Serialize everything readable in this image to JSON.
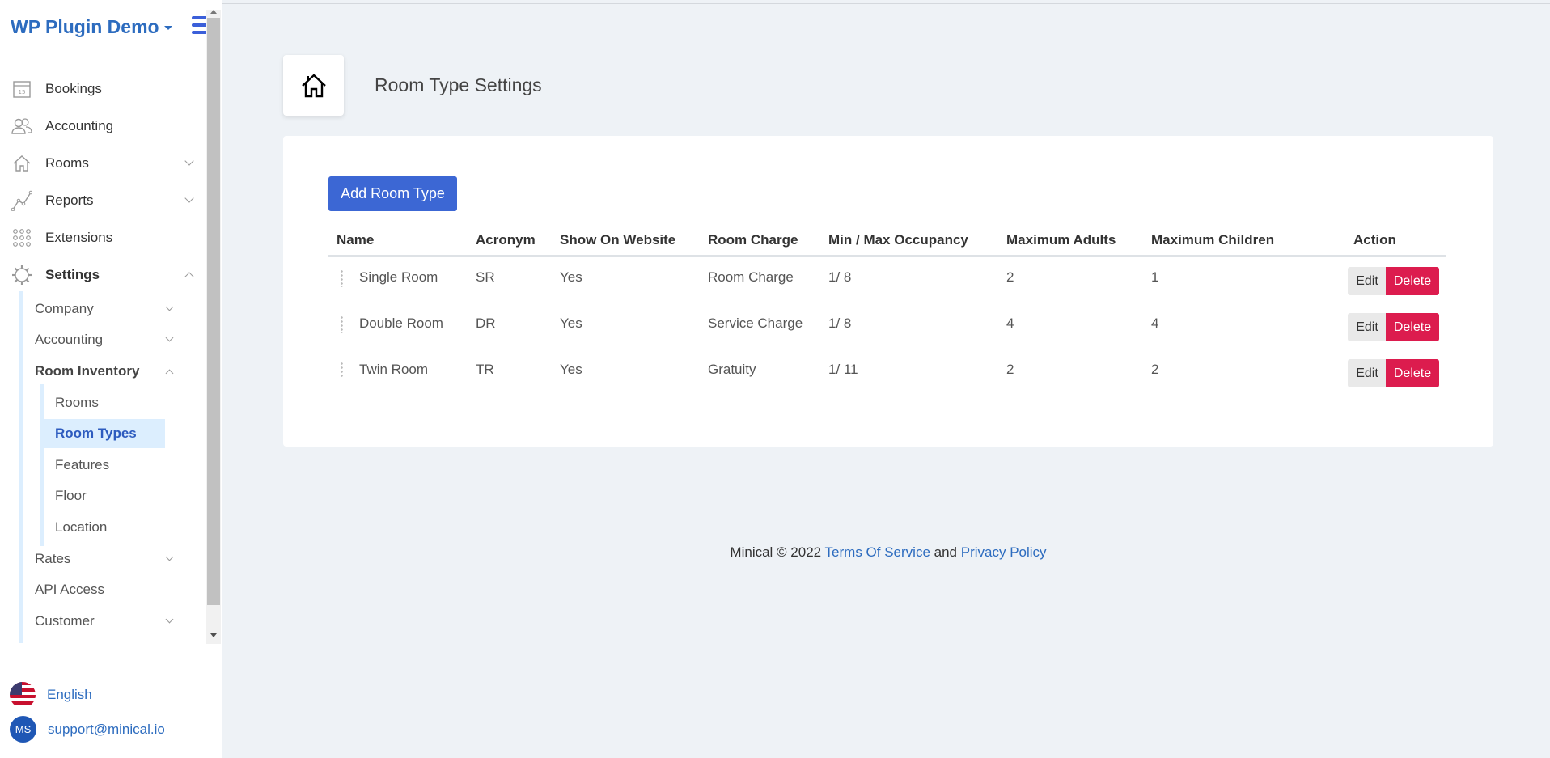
{
  "app": {
    "brand": "WP Plugin Demo"
  },
  "sidebar": {
    "items": [
      {
        "label": "Bookings",
        "icon": "calendar-icon"
      },
      {
        "label": "Accounting",
        "icon": "users-icon"
      },
      {
        "label": "Rooms",
        "icon": "home-icon"
      },
      {
        "label": "Reports",
        "icon": "chart-line-icon"
      },
      {
        "label": "Extensions",
        "icon": "grid-icon"
      },
      {
        "label": "Settings",
        "icon": "gear-icon"
      }
    ],
    "settings_sub": [
      {
        "label": "Company"
      },
      {
        "label": "Accounting"
      },
      {
        "label": "Room Inventory"
      },
      {
        "label": "Rates"
      },
      {
        "label": "API Access"
      },
      {
        "label": "Customer"
      }
    ],
    "inventory_sub": [
      {
        "label": "Rooms"
      },
      {
        "label": "Room Types"
      },
      {
        "label": "Features"
      },
      {
        "label": "Floor"
      },
      {
        "label": "Location"
      }
    ],
    "language": "English",
    "avatar_initials": "MS",
    "user_email": "support@minical.io"
  },
  "page": {
    "title": "Room Type Settings",
    "add_button": "Add Room Type"
  },
  "table": {
    "headers": [
      "Name",
      "Acronym",
      "Show On Website",
      "Room Charge",
      "Min / Max Occupancy",
      "Maximum Adults",
      "Maximum Children",
      "Action"
    ],
    "rows": [
      [
        "Single Room",
        "SR",
        "Yes",
        "Room Charge",
        "1/ 8",
        "2",
        "1"
      ],
      [
        "Double Room",
        "DR",
        "Yes",
        "Service Charge",
        "1/ 8",
        "4",
        "4"
      ],
      [
        "Twin Room",
        "TR",
        "Yes",
        "Gratuity",
        "1/ 11",
        "2",
        "2"
      ]
    ],
    "edit_label": "Edit",
    "delete_label": "Delete"
  },
  "footer": {
    "prefix": "Minical © 2022",
    "terms": "Terms Of Service",
    "and": "and",
    "privacy": "Privacy Policy"
  },
  "colors": {
    "accent": "#3c67d4",
    "danger": "#dc1c4e",
    "link": "#2d6cbf",
    "active_bg": "#dceefe"
  }
}
